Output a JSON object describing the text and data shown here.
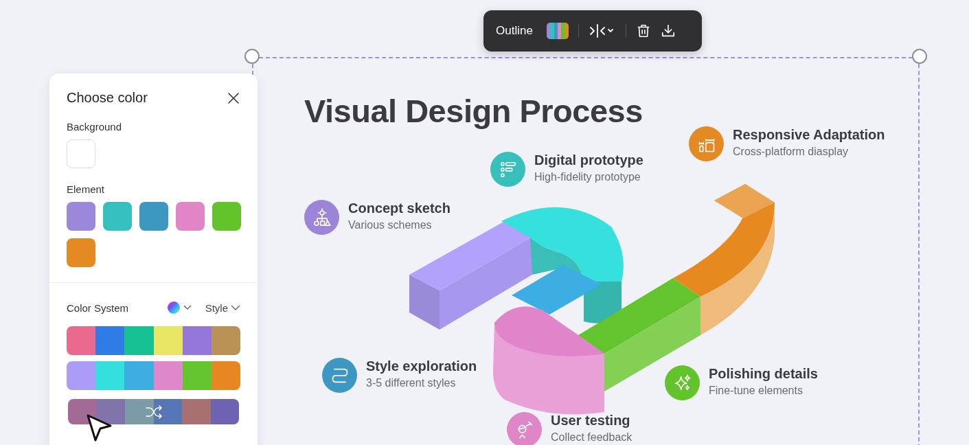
{
  "toolbar": {
    "label": "Outline"
  },
  "color_panel": {
    "title": "Choose color",
    "background_label": "Background",
    "background_swatch": {
      "color": "#ffffff"
    },
    "element_label": "Element",
    "element_swatches": [
      {
        "color": "#9b88d9"
      },
      {
        "color": "#36c0bd"
      },
      {
        "color": "#3c98c0"
      },
      {
        "color": "#e086c7"
      },
      {
        "color": "#62c32b"
      },
      {
        "color": "#e48a22"
      }
    ],
    "color_system_label": "Color System",
    "style_label": "Style",
    "palettes": [
      {
        "swatches": [
          {
            "color": "#e96a8e"
          },
          {
            "color": "#2f7ce6"
          },
          {
            "color": "#17c290"
          },
          {
            "color": "#e9e564"
          },
          {
            "color": "#9577dc"
          },
          {
            "color": "#b99355"
          }
        ]
      },
      {
        "swatches": [
          {
            "color": "#ab9cf8"
          },
          {
            "color": "#34e0dc"
          },
          {
            "color": "#3dade2"
          },
          {
            "color": "#df87cb"
          },
          {
            "color": "#63c42d"
          },
          {
            "color": "#e68722"
          }
        ]
      },
      {
        "swatches": [
          {
            "color": "#a36a98"
          },
          {
            "color": "#8074aa"
          },
          {
            "color": "#7b9ba8"
          },
          {
            "color": "#5776b5"
          },
          {
            "color": "#a87070"
          },
          {
            "color": "#6e63b0"
          }
        ]
      }
    ]
  },
  "canvas": {
    "title": "Visual Design Process",
    "steps": [
      {
        "title": "Responsive Adaptation",
        "subtitle": "Cross-platform diasplay",
        "color": "#e48a22"
      },
      {
        "title": "Digital prototype",
        "subtitle": "High-fidelity prototype",
        "color": "#36bfbb"
      },
      {
        "title": "Concept sketch",
        "subtitle": "Various schemes",
        "color": "#9c84d8"
      },
      {
        "title": "Style exploration",
        "subtitle": "3-5 different styles",
        "color": "#3c98c2"
      },
      {
        "title": "Polishing details",
        "subtitle": "Fine-tune elements",
        "color": "#62c32b"
      },
      {
        "title": "User testing",
        "subtitle": "Collect feedback",
        "color": "#df86c6"
      }
    ]
  }
}
